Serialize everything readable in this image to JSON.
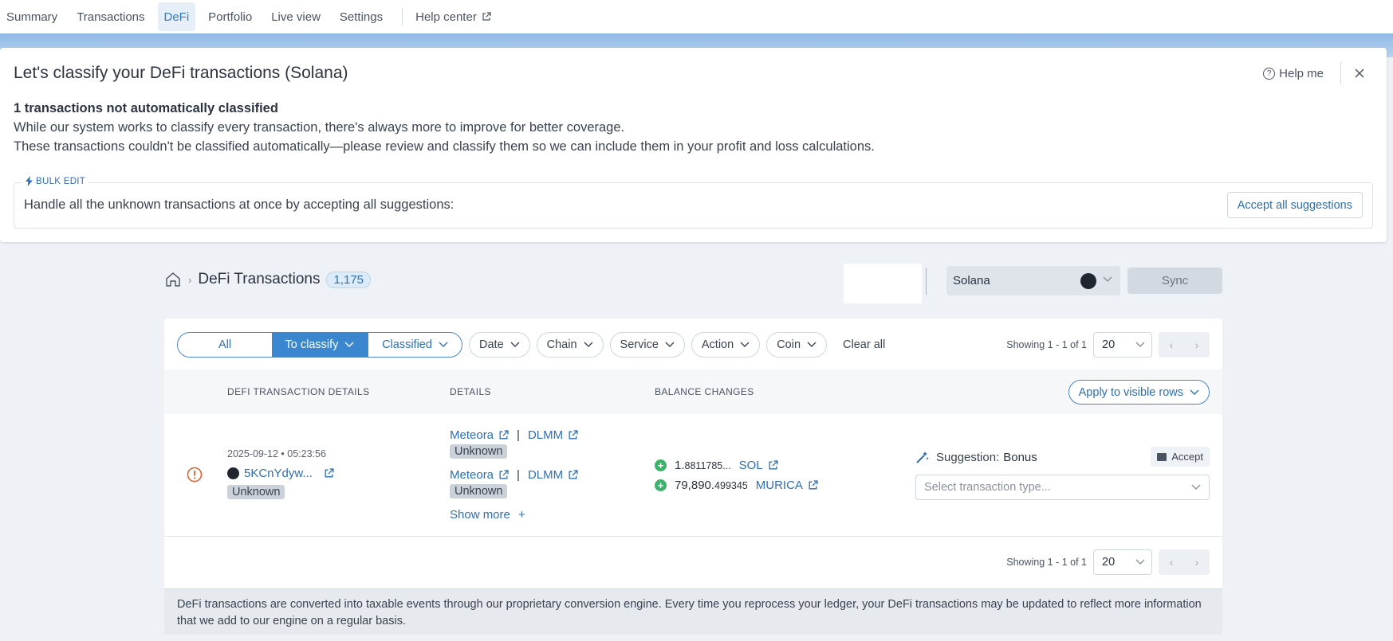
{
  "topnav": {
    "items": [
      {
        "label": "Summary"
      },
      {
        "label": "Transactions"
      },
      {
        "label": "DeFi"
      },
      {
        "label": "Portfolio"
      },
      {
        "label": "Live view"
      },
      {
        "label": "Settings"
      }
    ],
    "active": "DeFi",
    "help_label": "Help center"
  },
  "classify_panel": {
    "title": "Let's classify your DeFi transactions (Solana)",
    "help_label": "Help me",
    "not_classified": "1 transactions not automatically classified",
    "line2": "While our system works to classify every transaction, there's always more to improve for better coverage.",
    "line3": "These transactions couldn't be classified automatically—please review and classify them so we can include them in your profit and loss calculations.",
    "bulk": {
      "tag": "BULK EDIT",
      "text": "Handle all the unknown transactions at once by accepting all suggestions:",
      "button": "Accept all suggestions"
    }
  },
  "header": {
    "title": "DeFi Transactions",
    "count": "1,175",
    "chain": "Solana",
    "sync_label": "Sync"
  },
  "filters": {
    "seg_all": "All",
    "seg_to_classify": "To classify",
    "seg_classified": "Classified",
    "date": "Date",
    "chain": "Chain",
    "service": "Service",
    "action": "Action",
    "coin": "Coin",
    "clear_all": "Clear all"
  },
  "pager": {
    "showing": "Showing 1 - 1 of 1",
    "page_size": "20"
  },
  "table": {
    "col_details_main": "DEFI TRANSACTION DETAILS",
    "col_details": "DETAILS",
    "col_balance": "BALANCE CHANGES",
    "apply_label": "Apply to visible rows",
    "row": {
      "timestamp": "2025-09-12 • 05:23:56",
      "hash": "5KCnYdyw...",
      "status": "Unknown",
      "details": [
        {
          "service": "Meteora",
          "pool": "DLMM",
          "status": "Unknown"
        },
        {
          "service": "Meteora",
          "pool": "DLMM",
          "status": "Unknown"
        }
      ],
      "show_more": "Show more",
      "balances": [
        {
          "amount_main": "1.",
          "amount_rest": "8811785...",
          "coin": "SOL"
        },
        {
          "amount_main": "79,890.",
          "amount_rest": "499345",
          "coin": "MURICA"
        }
      ],
      "suggestion_label": "Suggestion:",
      "suggestion_value": "Bonus",
      "accept_label": "Accept",
      "type_placeholder": "Select transaction type..."
    }
  },
  "footnote": "DeFi transactions are converted into taxable events through our proprietary conversion engine. Every time you reprocess your ledger, your DeFi transactions may be updated to reflect more information that we add to our engine on a regular basis.",
  "colors": {
    "accent": "#2f6fb0",
    "segment_active": "#3a87d0",
    "positive": "#3bb36a",
    "warning": "#e0652f"
  }
}
